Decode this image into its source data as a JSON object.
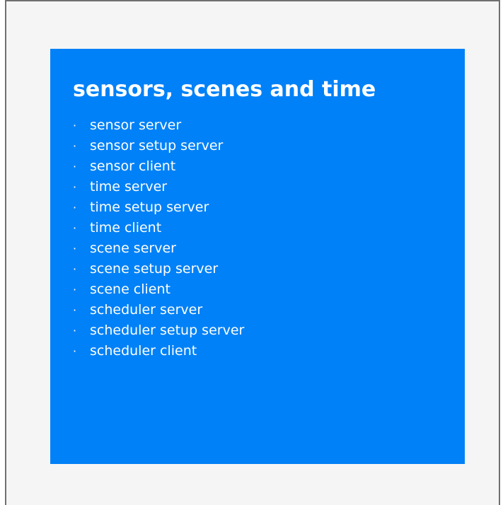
{
  "card": {
    "title": "sensors, scenes and time",
    "bullet": "·",
    "items": [
      "sensor server",
      "sensor setup server",
      "sensor client",
      "time server",
      "time setup server",
      "time client",
      "scene server",
      "scene setup server",
      "scene client",
      "scheduler server",
      "scheduler setup server",
      "scheduler client"
    ]
  },
  "colors": {
    "card_background": "#0081f7",
    "page_background": "#f5f5f5",
    "frame_border": "#6f6f6f",
    "text": "#ffffff"
  }
}
